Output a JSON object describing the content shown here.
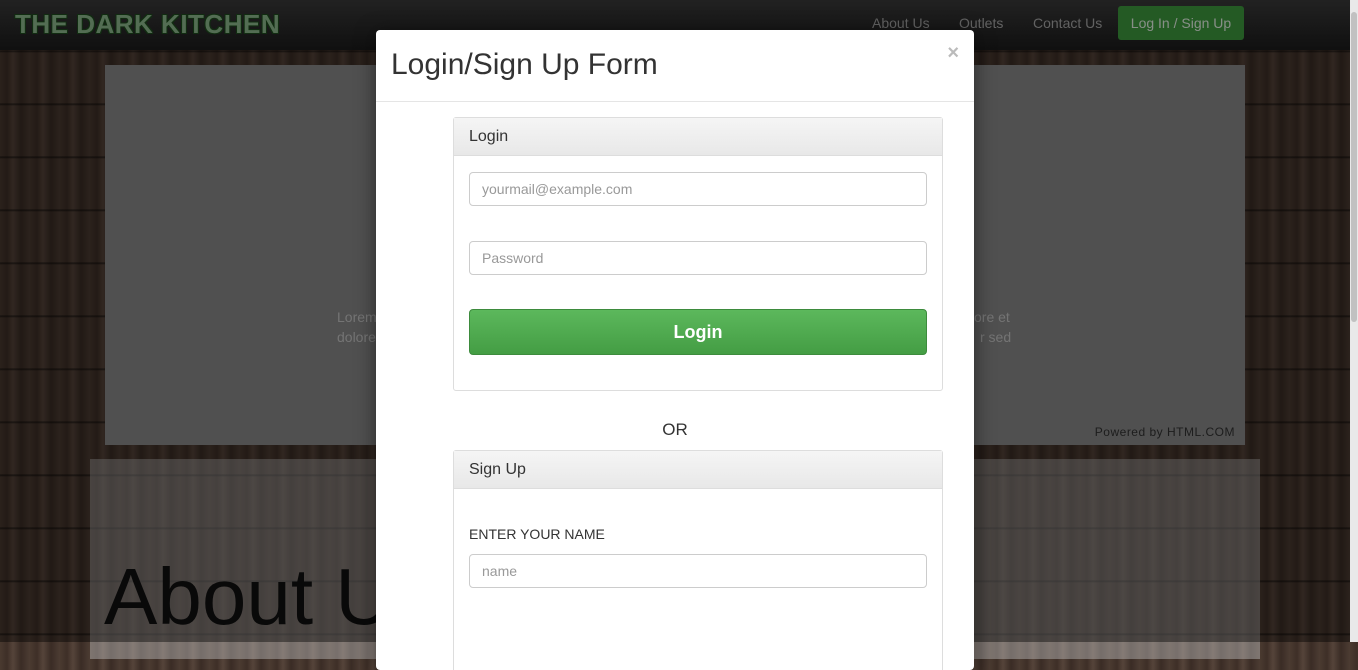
{
  "navbar": {
    "brand": "THE DARK KITCHEN",
    "links": [
      "About Us",
      "Outlets",
      "Contact Us"
    ],
    "login_button": "Log In / Sign Up"
  },
  "background": {
    "carousel_text_left_1": "Lorem",
    "carousel_text_left_2": "dolore",
    "carousel_text_right_1": "ore et",
    "carousel_text_right_2": "r sed",
    "powered_by": "Powered by HTML.COM",
    "about_title": "About U"
  },
  "modal": {
    "title": "Login/Sign Up Form",
    "close": "×",
    "login_panel": {
      "heading": "Login",
      "email_placeholder": "yourmail@example.com",
      "password_placeholder": "Password",
      "submit": "Login"
    },
    "separator": "OR",
    "signup_panel": {
      "heading": "Sign Up",
      "name_label": "ENTER YOUR NAME",
      "name_placeholder": "name"
    }
  }
}
